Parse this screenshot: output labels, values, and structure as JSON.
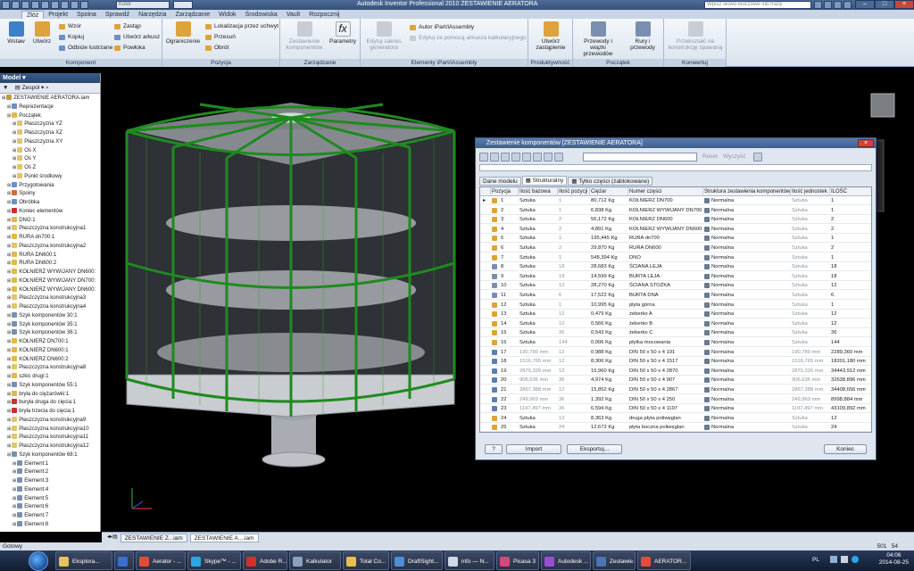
{
  "titlebar": {
    "color_combo": "Kolor",
    "title": "Autodesk Inventor Professional 2010  ZESTAWIENIE AERATORA",
    "search_placeholder": "Wpisz słowo kluczowe lub frazę"
  },
  "ribbon_tabs": [
    "Złóż",
    "Projekt",
    "Spoina",
    "Sprawdź",
    "Narzędzia",
    "Zarządzanie",
    "Widok",
    "Środowiska",
    "Vault",
    "Rozpocznij"
  ],
  "ribbon": {
    "komponent": {
      "label": "Komponent",
      "wstaw": "Wstaw",
      "utworz": "Utwórz",
      "wzor": "Wzór",
      "kopiuj": "Kopiuj",
      "odbicie": "Odbicie lustrzane",
      "zastap": "Zastąp",
      "utworz_arkusz": "Utwórz arkusz",
      "powloka": "Powłoka"
    },
    "pozycja": {
      "label": "Pozycja",
      "ograniczenie": "Ograniczenie",
      "lokalizacja": "Lokalizacja przez uchwyt",
      "przesun": "Przesuń",
      "obrot": "Obrót"
    },
    "zarzadzanie": {
      "label": "Zarządzanie",
      "zestawienie": "Zestawienie komponentów",
      "parametry": "Parametry"
    },
    "ipart": {
      "label": "Elementy iPart/iAssembly",
      "edytuj_zakres": "Edytuj zakres generatora",
      "autor": "Autor iPart/iAssembly",
      "edytuj_arkusz": "Edytuj za pomocą arkusza kalkulacyjnego"
    },
    "produktywnosc": {
      "label": "Produktywność",
      "utworz_zastapienie": "Utwórz zastąpienie"
    },
    "poczatek": {
      "label": "Początek",
      "przewody": "Przewody i wiązki przewodów",
      "rury": "Rury i przewody"
    },
    "konwertuj": {
      "label": "Konwertuj",
      "przeksztalc": "Przekształć na konstrukcję spawaną"
    }
  },
  "browser": {
    "header": "Model",
    "toolbar_label": "Zespół",
    "items": [
      {
        "label": "ZESTAWIENIE AERATORA.iam",
        "indent": 0,
        "color": "#c79a3a"
      },
      {
        "label": "Reprezentacje",
        "indent": 1,
        "color": "#6c8fc7"
      },
      {
        "label": "Początek",
        "indent": 1,
        "color": "#e0b94a"
      },
      {
        "label": "Płaszczyzna YZ",
        "indent": 2,
        "color": "#e0c56a"
      },
      {
        "label": "Płaszczyzna XZ",
        "indent": 2,
        "color": "#e0c56a"
      },
      {
        "label": "Płaszczyzna XY",
        "indent": 2,
        "color": "#e0c56a"
      },
      {
        "label": "Oś X",
        "indent": 2,
        "color": "#e0c56a"
      },
      {
        "label": "Oś Y",
        "indent": 2,
        "color": "#e0c56a"
      },
      {
        "label": "Oś Z",
        "indent": 2,
        "color": "#e0c56a"
      },
      {
        "label": "Punkt środkowy",
        "indent": 2,
        "color": "#e0c56a"
      },
      {
        "label": "Przygotowania",
        "indent": 1,
        "color": "#6c8fc7"
      },
      {
        "label": "Spoiny",
        "indent": 1,
        "color": "#d36a3a"
      },
      {
        "label": "Obróbka",
        "indent": 1,
        "color": "#6c8fc7"
      },
      {
        "label": "Koniec elementów",
        "indent": 1,
        "color": "#c93030"
      },
      {
        "label": "DNO:1",
        "indent": 1,
        "color": "#e0b94a"
      },
      {
        "label": "Płaszczyzna konstrukcyjna1",
        "indent": 1,
        "color": "#e0c56a"
      },
      {
        "label": "RURA dn700:1",
        "indent": 1,
        "color": "#e0b94a"
      },
      {
        "label": "Płaszczyzna konstrukcyjna2",
        "indent": 1,
        "color": "#e0c56a"
      },
      {
        "label": "RURA DN600:1",
        "indent": 1,
        "color": "#e0b94a"
      },
      {
        "label": "RURA DN600:2",
        "indent": 1,
        "color": "#e0b94a"
      },
      {
        "label": "KOŁNIERZ WYWIJANY DN600:",
        "indent": 1,
        "color": "#e0b94a"
      },
      {
        "label": "KOŁNIERZ WYWIJANY DN700:",
        "indent": 1,
        "color": "#e0b94a"
      },
      {
        "label": "KOŁNIERZ WYWIJANY DN600:",
        "indent": 1,
        "color": "#e0b94a"
      },
      {
        "label": "Płaszczyzna konstrukcyjna3",
        "indent": 1,
        "color": "#e0c56a"
      },
      {
        "label": "Płaszczyzna konstrukcyjna4",
        "indent": 1,
        "color": "#e0c56a"
      },
      {
        "label": "Szyk komponentów 30:1",
        "indent": 1,
        "color": "#7a8fb0"
      },
      {
        "label": "Szyk komponentów 35:1",
        "indent": 1,
        "color": "#7a8fb0"
      },
      {
        "label": "Szyk komponentów 36:1",
        "indent": 1,
        "color": "#7a8fb0"
      },
      {
        "label": "KOŁNIERZ DN700:1",
        "indent": 1,
        "color": "#e0b94a"
      },
      {
        "label": "KOŁNIERZ DN600:1",
        "indent": 1,
        "color": "#e0b94a"
      },
      {
        "label": "KOŁNIERZ DN600:2",
        "indent": 1,
        "color": "#e0b94a"
      },
      {
        "label": "Płaszczyzna konstrukcyjna8",
        "indent": 1,
        "color": "#e0c56a"
      },
      {
        "label": "szkic drugi:1",
        "indent": 1,
        "color": "#e0b94a"
      },
      {
        "label": "Szyk komponentów 55:1",
        "indent": 1,
        "color": "#7a8fb0"
      },
      {
        "label": "bryła do ciężarówki:1",
        "indent": 1,
        "color": "#e0b94a"
      },
      {
        "label": "buryła druga do cięcia:1",
        "indent": 1,
        "color": "#c93030"
      },
      {
        "label": "bryła trzecia do cięcia:1",
        "indent": 1,
        "color": "#c93030"
      },
      {
        "label": "Płaszczyzna konstrukcyjna9",
        "indent": 1,
        "color": "#e0c56a"
      },
      {
        "label": "Płaszczyzna konstrukcyjna10",
        "indent": 1,
        "color": "#e0c56a"
      },
      {
        "label": "Płaszczyzna konstrukcyjna11",
        "indent": 1,
        "color": "#e0c56a"
      },
      {
        "label": "Płaszczyzna konstrukcyjna12",
        "indent": 1,
        "color": "#e0c56a"
      },
      {
        "label": "Szyk komponentów 68:1",
        "indent": 1,
        "color": "#7a8fb0"
      },
      {
        "label": "Element:1",
        "indent": 2,
        "color": "#7a8fb0"
      },
      {
        "label": "Element:2",
        "indent": 2,
        "color": "#7a8fb0"
      },
      {
        "label": "Element:3",
        "indent": 2,
        "color": "#7a8fb0"
      },
      {
        "label": "Element:4",
        "indent": 2,
        "color": "#7a8fb0"
      },
      {
        "label": "Element:5",
        "indent": 2,
        "color": "#7a8fb0"
      },
      {
        "label": "Element:6",
        "indent": 2,
        "color": "#7a8fb0"
      },
      {
        "label": "Element:7",
        "indent": 2,
        "color": "#7a8fb0"
      },
      {
        "label": "Element:8",
        "indent": 2,
        "color": "#7a8fb0"
      }
    ]
  },
  "dialog": {
    "title": "Zestawienie komponentów [ZESTAWIENIE AERATORA]",
    "toolbar": {
      "reset": "Reset",
      "wyczysc": "Wyczyść"
    },
    "tabs": [
      "Dane modelu",
      "Strukturalny",
      "Tylko części (zablokowane)"
    ],
    "columns": [
      "Pozycja",
      "Ilość bazowa",
      "Ilość pozycji",
      "Ciężar",
      "Numer części",
      "Struktura zestawienia komponentów",
      "Ilość jednostek",
      "ILOŚĆ"
    ],
    "rows": [
      {
        "pos": "1",
        "base": "Sztuka",
        "qty": "1",
        "mass": "80,712 Kg",
        "part": "KOŁNIERZ DN700",
        "struct": "Normalna",
        "unit": "Sztuka",
        "total": "1",
        "icon": "part"
      },
      {
        "pos": "2",
        "base": "Sztuka",
        "qty": "1",
        "mass": "6,838 Kg",
        "part": "KOŁNIERZ WYWIJANY DN700",
        "struct": "Normalna",
        "unit": "Sztuka",
        "total": "1",
        "icon": "part"
      },
      {
        "pos": "3",
        "base": "Sztuka",
        "qty": "2",
        "mass": "56,172 Kg",
        "part": "KOŁNIERZ DN600",
        "struct": "Normalna",
        "unit": "Sztuka",
        "total": "2",
        "icon": "part"
      },
      {
        "pos": "4",
        "base": "Sztuka",
        "qty": "2",
        "mass": "4,891 Kg",
        "part": "KOŁNIERZ WYWIJANY DN600",
        "struct": "Normalna",
        "unit": "Sztuka",
        "total": "2",
        "icon": "part"
      },
      {
        "pos": "5",
        "base": "Sztuka",
        "qty": "1",
        "mass": "195,445 Kg",
        "part": "RURA dn700",
        "struct": "Normalna",
        "unit": "Sztuka",
        "total": "1",
        "icon": "part"
      },
      {
        "pos": "6",
        "base": "Sztuka",
        "qty": "2",
        "mass": "29,870 Kg",
        "part": "RURA DN600",
        "struct": "Normalna",
        "unit": "Sztuka",
        "total": "2",
        "icon": "part"
      },
      {
        "pos": "7",
        "base": "Sztuka",
        "qty": "1",
        "mass": "548,394 Kg",
        "part": "DNO",
        "struct": "Normalna",
        "unit": "Sztuka",
        "total": "1",
        "icon": "part"
      },
      {
        "pos": "8",
        "base": "Sztuka",
        "qty": "18",
        "mass": "28,683 Kg",
        "part": "ŚCIANA LEJA",
        "struct": "Normalna",
        "unit": "Sztuka",
        "total": "18",
        "icon": "pattern"
      },
      {
        "pos": "9",
        "base": "Sztuka",
        "qty": "18",
        "mass": "14,599 Kg",
        "part": "BURTA LEJA",
        "struct": "Normalna",
        "unit": "Sztuka",
        "total": "18",
        "icon": "pattern"
      },
      {
        "pos": "10",
        "base": "Sztuka",
        "qty": "12",
        "mass": "28,270 Kg",
        "part": "ŚCIANA STOŻKA",
        "struct": "Normalna",
        "unit": "Sztuka",
        "total": "12",
        "icon": "pattern"
      },
      {
        "pos": "11",
        "base": "Sztuka",
        "qty": "6",
        "mass": "17,522 Kg",
        "part": "BURTA DNA",
        "struct": "Normalna",
        "unit": "Sztuka",
        "total": "6",
        "icon": "pattern"
      },
      {
        "pos": "12",
        "base": "Sztuka",
        "qty": "1",
        "mass": "10,995 Kg",
        "part": "płyta górna",
        "struct": "Normalna",
        "unit": "Sztuka",
        "total": "1",
        "icon": "part"
      },
      {
        "pos": "13",
        "base": "Sztuka",
        "qty": "12",
        "mass": "0,479 Kg",
        "part": "żeberko A",
        "struct": "Normalna",
        "unit": "Sztuka",
        "total": "12",
        "icon": "part"
      },
      {
        "pos": "14",
        "base": "Sztuka",
        "qty": "12",
        "mass": "0,566 Kg",
        "part": "żeberko B",
        "struct": "Normalna",
        "unit": "Sztuka",
        "total": "12",
        "icon": "part"
      },
      {
        "pos": "15",
        "base": "Sztuka",
        "qty": "36",
        "mass": "0,543 Kg",
        "part": "żeberko C",
        "struct": "Normalna",
        "unit": "Sztuka",
        "total": "36",
        "icon": "part"
      },
      {
        "pos": "16",
        "base": "Sztuka",
        "qty": "144",
        "mass": "0,006 Kg",
        "part": "płytka mocowania",
        "struct": "Normalna",
        "unit": "Sztuka",
        "total": "144",
        "icon": "part"
      },
      {
        "pos": "17",
        "base": "190,780 mm",
        "qty": "12",
        "mass": "0,988 Kg",
        "part": "DIN 50 x 50 x 4 191",
        "struct": "Normalna",
        "unit": "190,780 mm",
        "total": "2289,360 mm",
        "icon": "frame"
      },
      {
        "pos": "18",
        "base": "1516,765 mm",
        "qty": "12",
        "mass": "8,306 Kg",
        "part": "DIN 50 x 50 x 4 1517",
        "struct": "Normalna",
        "unit": "1516,765 mm",
        "total": "18201,180 mm",
        "icon": "frame"
      },
      {
        "pos": "19",
        "base": "2870,326 mm",
        "qty": "12",
        "mass": "15,960 Kg",
        "part": "DIN 50 x 50 x 4 2870",
        "struct": "Normalna",
        "unit": "2870,326 mm",
        "total": "34443,912 mm",
        "icon": "frame"
      },
      {
        "pos": "20",
        "base": "906,636 mm",
        "qty": "36",
        "mass": "4,974 Kg",
        "part": "DIN 50 x 50 x 4 907",
        "struct": "Normalna",
        "unit": "906,636 mm",
        "total": "32638,896 mm",
        "icon": "frame"
      },
      {
        "pos": "21",
        "base": "2867,388 mm",
        "qty": "12",
        "mass": "15,852 Kg",
        "part": "DIN 50 x 50 x 4 2867",
        "struct": "Normalna",
        "unit": "2867,388 mm",
        "total": "34408,656 mm",
        "icon": "frame"
      },
      {
        "pos": "22",
        "base": "249,969 mm",
        "qty": "36",
        "mass": "1,392 Kg",
        "part": "DIN 50 x 50 x 4 250",
        "struct": "Normalna",
        "unit": "249,969 mm",
        "total": "8998,884 mm",
        "icon": "frame"
      },
      {
        "pos": "23",
        "base": "1197,497 mm",
        "qty": "36",
        "mass": "6,594 Kg",
        "part": "DIN 50 x 50 x 4 1197",
        "struct": "Normalna",
        "unit": "1197,497 mm",
        "total": "43109,892 mm",
        "icon": "frame"
      },
      {
        "pos": "24",
        "base": "Sztuka",
        "qty": "12",
        "mass": "8,363 Kg",
        "part": "druga płyta poliwęglan",
        "struct": "Normalna",
        "unit": "Sztuka",
        "total": "12",
        "icon": "part"
      },
      {
        "pos": "25",
        "base": "Sztuka",
        "qty": "24",
        "mass": "12,672 Kg",
        "part": "płyta boczna poliwęglan",
        "struct": "Normalna",
        "unit": "Sztuka",
        "total": "24",
        "icon": "part"
      }
    ],
    "buttons": {
      "help": "?",
      "import": "Import",
      "export": "Eksportuj...",
      "close": "Koniec"
    }
  },
  "doc_tabs": [
    "ZESTAWIENIE Z...iam",
    "ZESTAWIENIE A....iam"
  ],
  "status": {
    "text": "Gotowy",
    "x": "501",
    "y": "54"
  },
  "taskbar": {
    "items": [
      {
        "label": "Eksplora...",
        "color": "#e7c15a"
      },
      {
        "label": "",
        "color": "#3a6ed1"
      },
      {
        "label": "Aerator - ...",
        "color": "#e24b3b"
      },
      {
        "label": "Skype™ - ...",
        "color": "#2aa7e6"
      },
      {
        "label": "Adobe R...",
        "color": "#d3302a"
      },
      {
        "label": "Kalkulator",
        "color": "#8aa0bf"
      },
      {
        "label": "Total Co...",
        "color": "#e6c04a"
      },
      {
        "label": "DraftSight...",
        "color": "#4d8ed6"
      },
      {
        "label": "info — N...",
        "color": "#cfd8e6"
      },
      {
        "label": "Picasa 3",
        "color": "#d6477a"
      },
      {
        "label": "Autodesk ...",
        "color": "#9a4ed1"
      },
      {
        "label": "Zestawie...",
        "color": "#4c74b3"
      },
      {
        "label": "AERATOR...",
        "color": "#e24b3b"
      }
    ],
    "lang": "PL",
    "time": "04:06",
    "date": "2014-08-25"
  }
}
